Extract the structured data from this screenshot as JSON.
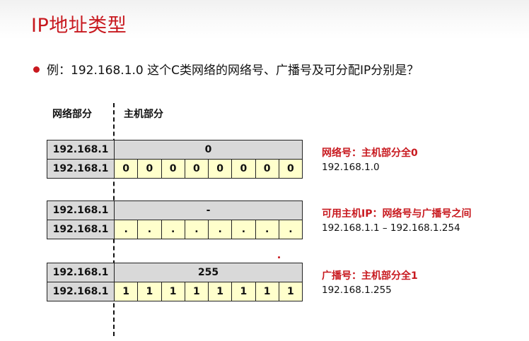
{
  "title": "IP地址类型",
  "bullet": "例：192.168.1.0 这个C类网络的网络号、广播号及可分配IP分别是？",
  "headers": {
    "net": "网络部分",
    "host": "主机部分"
  },
  "tables": [
    {
      "net_top": "192.168.1",
      "host_top": "0",
      "net_bottom": "192.168.1",
      "bits": [
        "0",
        "0",
        "0",
        "0",
        "0",
        "0",
        "0",
        "0"
      ]
    },
    {
      "net_top": "192.168.1",
      "host_top": "-",
      "net_bottom": "192.168.1",
      "bits": [
        ".",
        ".",
        ".",
        ".",
        ".",
        ".",
        ".",
        "."
      ]
    },
    {
      "net_top": "192.168.1",
      "host_top": "255",
      "net_bottom": "192.168.1",
      "bits": [
        "1",
        "1",
        "1",
        "1",
        "1",
        "1",
        "1",
        "1"
      ]
    }
  ],
  "notes": [
    {
      "label": "网络号：主机部分全0",
      "value": "192.168.1.0"
    },
    {
      "label": "可用主机IP：网络号与广播号之间",
      "value": "192.168.1.1 – 192.168.1.254"
    },
    {
      "label": "广播号：主机部分全1",
      "value": "192.168.1.255"
    }
  ],
  "colors": {
    "accent": "#c8191f",
    "header_cell": "#d9d9d9",
    "bit_cell": "#ffffcc"
  }
}
